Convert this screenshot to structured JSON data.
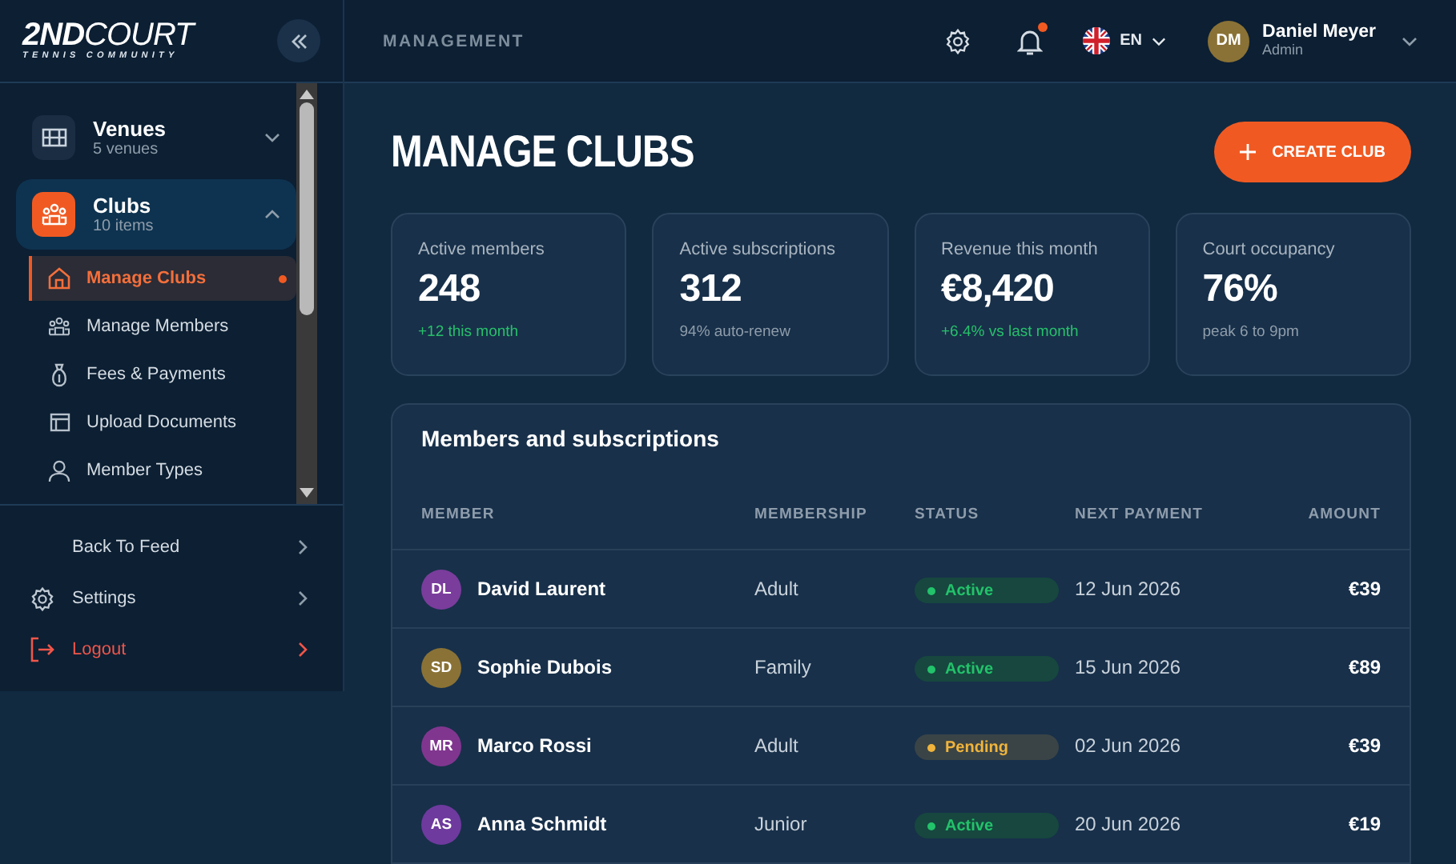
{
  "brand": {
    "logo": "**2ND**COURT",
    "tagline": "TENNIS COMMUNITY"
  },
  "sidebar": {
    "groups": [
      {
        "label": "Venues",
        "sub": "5 venues",
        "expanded": false,
        "selected": false
      },
      {
        "label": "Clubs",
        "sub": "10 items",
        "expanded": true,
        "selected": true,
        "children": [
          {
            "label": "Manage Clubs",
            "selected": true
          },
          {
            "label": "Manage Members",
            "selected": false
          },
          {
            "label": "Fees & Payments",
            "selected": false
          },
          {
            "label": "Upload Documents",
            "selected": false
          },
          {
            "label": "Member Types",
            "selected": false
          }
        ]
      }
    ],
    "footer": [
      {
        "label": "Back To Feed",
        "kind": "plain"
      },
      {
        "label": "Settings",
        "kind": "settings"
      },
      {
        "label": "Logout",
        "kind": "logout"
      }
    ]
  },
  "header": {
    "section": "MANAGEMENT",
    "notifications_unread": true,
    "language": "EN",
    "user": {
      "initials": "DM",
      "name": "Daniel Meyer",
      "role": "Admin"
    }
  },
  "page": {
    "title": "MANAGE CLUBS",
    "create_button": "CREATE CLUB"
  },
  "stats": [
    {
      "label": "Active members",
      "value": "248",
      "note": "+12 this month",
      "kind": "positive"
    },
    {
      "label": "Active subscriptions",
      "value": "312",
      "note": "94% auto-renew",
      "kind": "neutral"
    },
    {
      "label": "Revenue this month",
      "value": "€8,420",
      "note": "+6.4% vs last month",
      "kind": "positive"
    },
    {
      "label": "Court occupancy",
      "value": "76%",
      "note": "peak 6 to 9pm",
      "kind": "neutral"
    }
  ],
  "table": {
    "title": "Members and subscriptions",
    "columns": [
      "MEMBER",
      "MEMBERSHIP",
      "STATUS",
      "NEXT PAYMENT",
      "AMOUNT"
    ],
    "rows": [
      {
        "initials": "DL",
        "color": "#7a3d9c",
        "name": "David Laurent",
        "membership": "Adult",
        "status": {
          "label": "Active",
          "kind": "active"
        },
        "next_payment": "12 Jun 2026",
        "amount": "€39"
      },
      {
        "initials": "SD",
        "color": "#8a7236",
        "name": "Sophie Dubois",
        "membership": "Family",
        "status": {
          "label": "Active",
          "kind": "active"
        },
        "next_payment": "15 Jun 2026",
        "amount": "€89"
      },
      {
        "initials": "MR",
        "color": "#80368f",
        "name": "Marco Rossi",
        "membership": "Adult",
        "status": {
          "label": "Pending",
          "kind": "pending"
        },
        "next_payment": "02 Jun 2026",
        "amount": "€39"
      },
      {
        "initials": "AS",
        "color": "#6e3a9e",
        "name": "Anna Schmidt",
        "membership": "Junior",
        "status": {
          "label": "Active",
          "kind": "active"
        },
        "next_payment": "20 Jun 2026",
        "amount": "€19"
      }
    ]
  }
}
